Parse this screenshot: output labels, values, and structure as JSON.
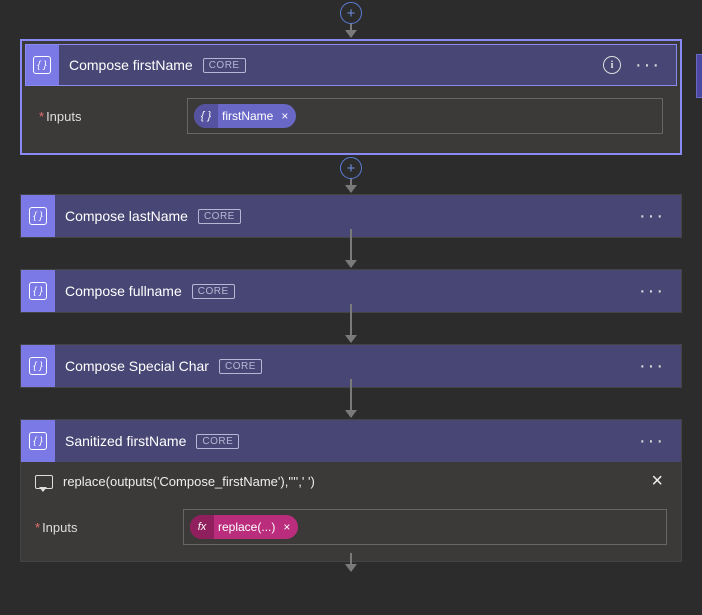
{
  "badge_label": "CORE",
  "inputs_label": "Inputs",
  "required_marker": "*",
  "actions": [
    {
      "id": "compose-firstname",
      "title": "Compose firstName",
      "expanded": true,
      "selected": true,
      "show_info": true,
      "add_before": true,
      "add_after": true,
      "token": {
        "type": "purple",
        "icon": "{ }",
        "label": "firstName"
      }
    },
    {
      "id": "compose-lastname",
      "title": "Compose lastName",
      "expanded": false
    },
    {
      "id": "compose-fullname",
      "title": "Compose fullname",
      "expanded": false
    },
    {
      "id": "compose-specialchar",
      "title": "Compose Special Char",
      "expanded": false
    },
    {
      "id": "sanitized-firstname",
      "title": "Sanitized firstName",
      "expanded": true,
      "expression": "replace(outputs('Compose_firstName'),'''',' ')",
      "token": {
        "type": "magenta",
        "icon": "fx",
        "label": "replace(...)"
      }
    }
  ]
}
